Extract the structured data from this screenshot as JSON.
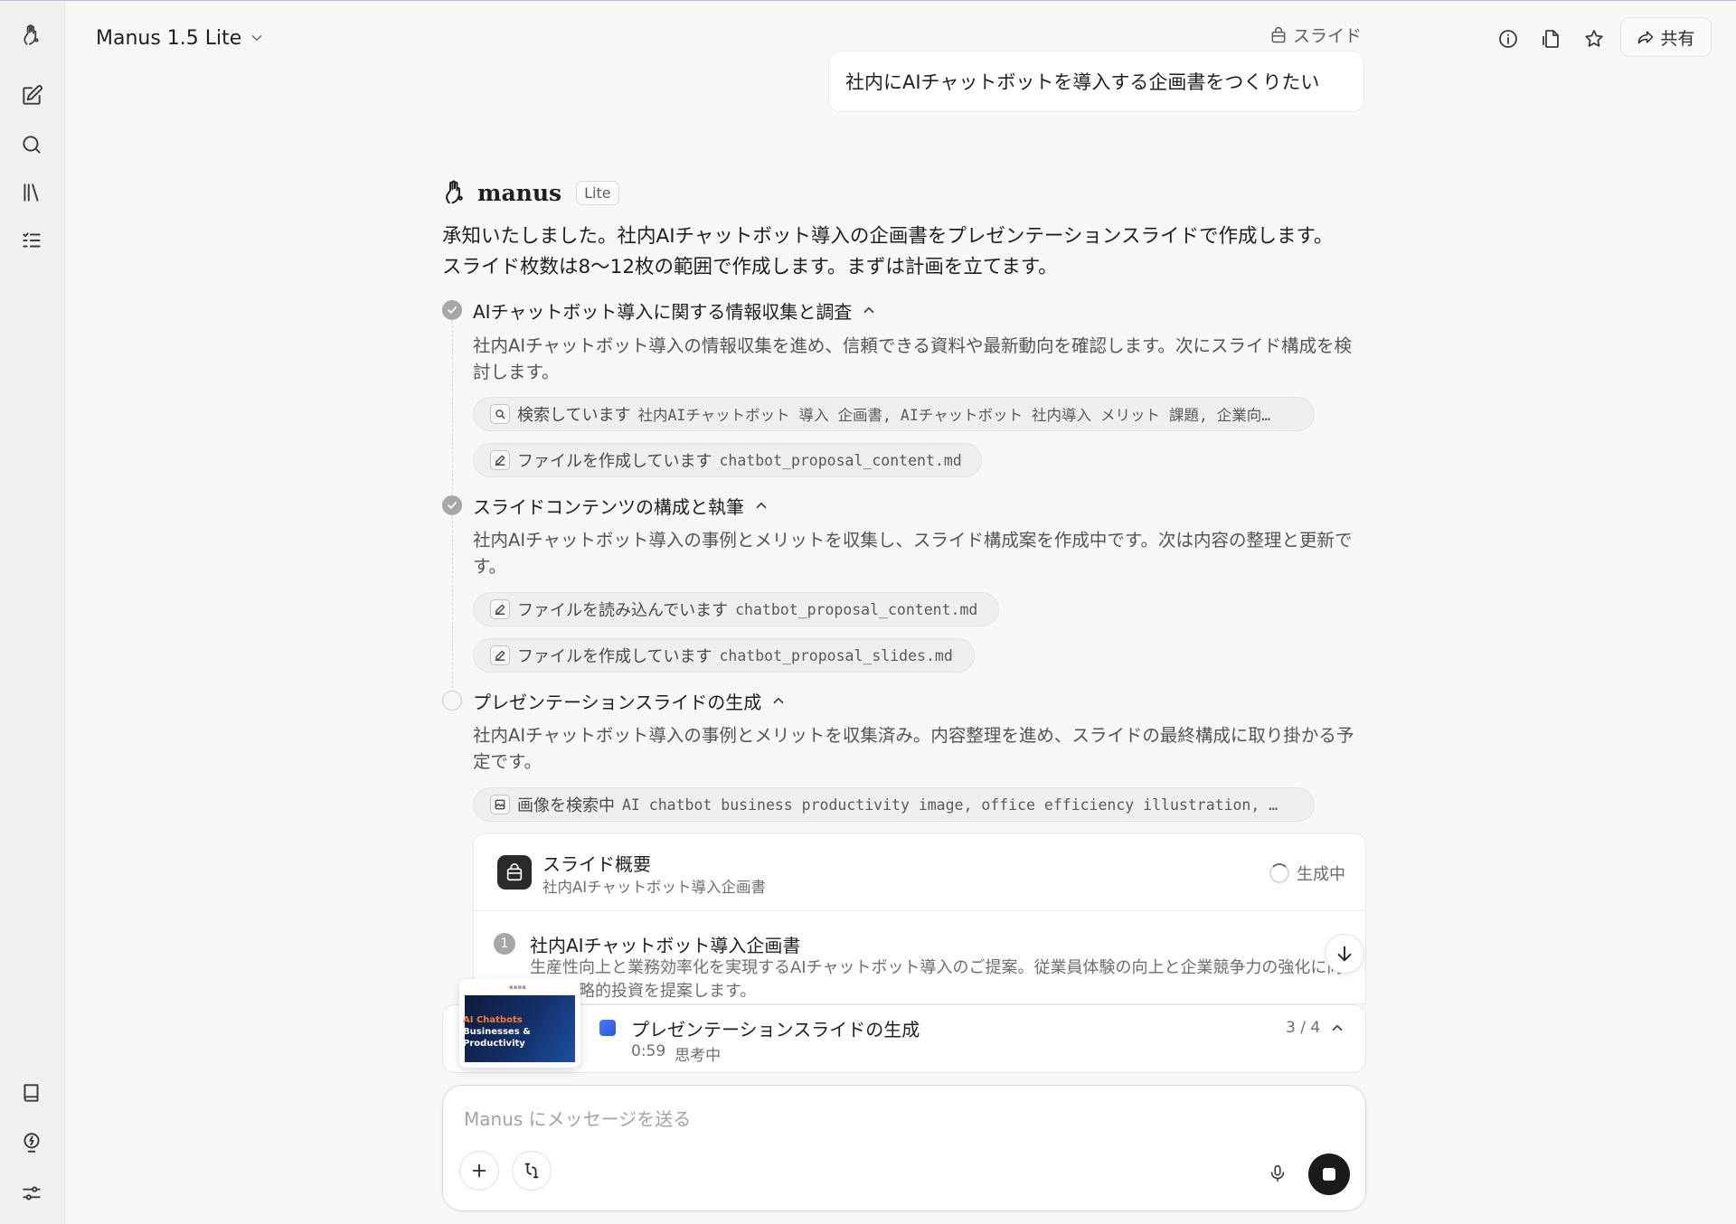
{
  "header": {
    "model": "Manus 1.5 Lite",
    "slide_tag": "スライド",
    "share_label": "共有"
  },
  "user_message": "社内にAIチャットボットを導入する企画書をつくりたい",
  "assistant": {
    "name": "manus",
    "badge": "Lite",
    "intro": "承知いたしました。社内AIチャットボット導入の企画書をプレゼンテーションスライドで作成します。スライド枚数は8〜12枚の範囲で作成します。まずは計画を立てます。"
  },
  "steps": [
    {
      "status": "done",
      "title": "AIチャットボット導入に関する情報収集と調査",
      "desc": "社内AIチャットボット導入の情報収集を進め、信頼できる資料や最新動向を確認します。次にスライド構成を検討します。",
      "tools": [
        {
          "icon": "search-icon",
          "action": "検索しています",
          "arg": "社内AIチャットボット 導入 企画書, AIチャットボット 社内導入 メリット 課題, 企業向…"
        },
        {
          "icon": "edit-icon",
          "action": "ファイルを作成しています",
          "arg": "chatbot_proposal_content.md"
        }
      ]
    },
    {
      "status": "done",
      "title": "スライドコンテンツの構成と執筆",
      "desc": "社内AIチャットボット導入の事例とメリットを収集し、スライド構成案を作成中です。次は内容の整理と更新です。",
      "tools": [
        {
          "icon": "edit-icon",
          "action": "ファイルを読み込んでいます",
          "arg": "chatbot_proposal_content.md"
        },
        {
          "icon": "edit-icon",
          "action": "ファイルを作成しています",
          "arg": "chatbot_proposal_slides.md"
        }
      ]
    },
    {
      "status": "pending",
      "title": "プレゼンテーションスライドの生成",
      "desc": "社内AIチャットボット導入の事例とメリットを収集済み。内容整理を進め、スライドの最終構成に取り掛かる予定です。",
      "tools": [
        {
          "icon": "image-icon",
          "action": "画像を検索中",
          "arg": "AI chatbot business productivity image, office efficiency illustration, …"
        }
      ]
    }
  ],
  "slides_card": {
    "title": "スライド概要",
    "subtitle": "社内AIチャットボット導入企画書",
    "status": "生成中",
    "item": {
      "number": "1",
      "title": "社内AIチャットボット導入企画書",
      "desc": "生産性向上と業務効率化を実現するAIチャットボット導入のご提案。従業員体験の向上と企業競争力の強化に向けた戦略的投資を提案します。"
    }
  },
  "progress": {
    "title": "プレゼンテーションスライドの生成",
    "time": "0:59",
    "state": "思考中",
    "count": "3 / 4",
    "thumb_line1": "AI Chatbots",
    "thumb_line2": "Businesses &",
    "thumb_line3": "Productivity"
  },
  "composer": {
    "placeholder": "Manus にメッセージを送る"
  },
  "colors": {
    "background": "#f8f8f7",
    "sidebar": "#f1f1f0",
    "accent_blue": "#4d7cf5",
    "stop_button": "#1a1a19"
  }
}
